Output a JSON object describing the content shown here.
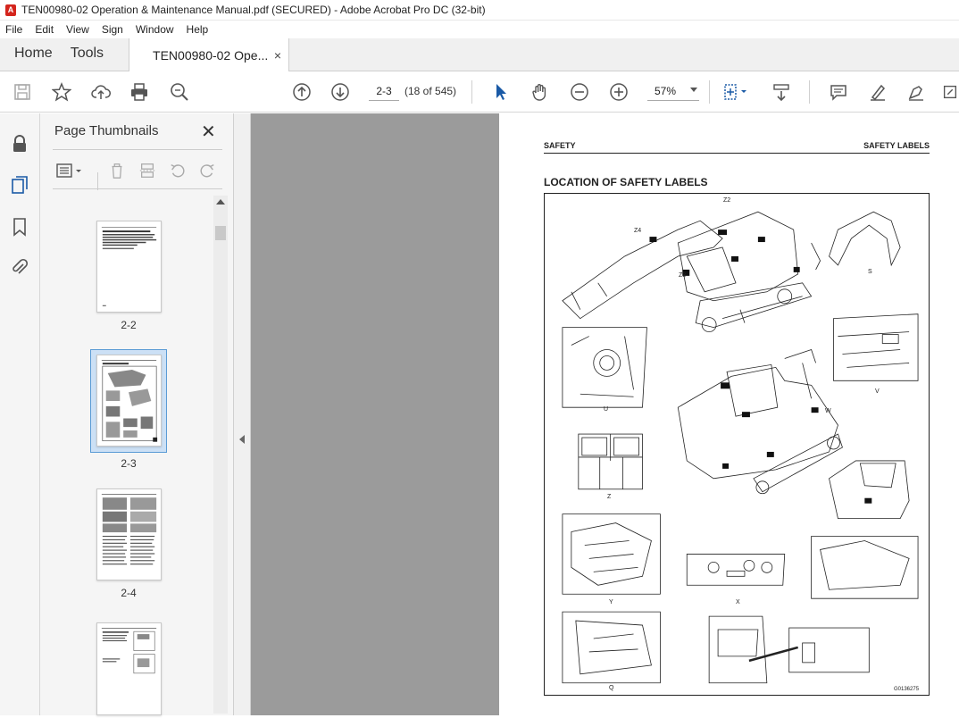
{
  "window": {
    "title": "TEN00980-02 Operation & Maintenance Manual.pdf (SECURED) - Adobe Acrobat Pro DC (32-bit)"
  },
  "menu": [
    "File",
    "Edit",
    "View",
    "Sign",
    "Window",
    "Help"
  ],
  "tabs": {
    "home": "Home",
    "tools": "Tools",
    "document": "TEN00980-02 Ope...",
    "close": "×"
  },
  "toolbar": {
    "page_number": "2-3",
    "page_count": "(18 of 545)",
    "zoom": "57%"
  },
  "thumbnails_panel": {
    "title": "Page Thumbnails",
    "close": "✕",
    "pages": [
      {
        "label": "2-2",
        "selected": false
      },
      {
        "label": "2-3",
        "selected": true
      },
      {
        "label": "2-4",
        "selected": false
      },
      {
        "label": "",
        "selected": false
      }
    ]
  },
  "document_page": {
    "header_left": "SAFETY",
    "header_right": "SAFETY LABELS",
    "heading": "LOCATION OF SAFETY LABELS",
    "figure_code": "G0136275",
    "figure_labels": [
      "Z2",
      "Z4",
      "Z3",
      "S",
      "U",
      "V",
      "W",
      "Z",
      "Y",
      "X",
      "Q"
    ]
  },
  "colors": {
    "accent_red": "#d4251d",
    "selection_blue": "#5a9bd5",
    "canvas_gray": "#9b9b9b"
  }
}
